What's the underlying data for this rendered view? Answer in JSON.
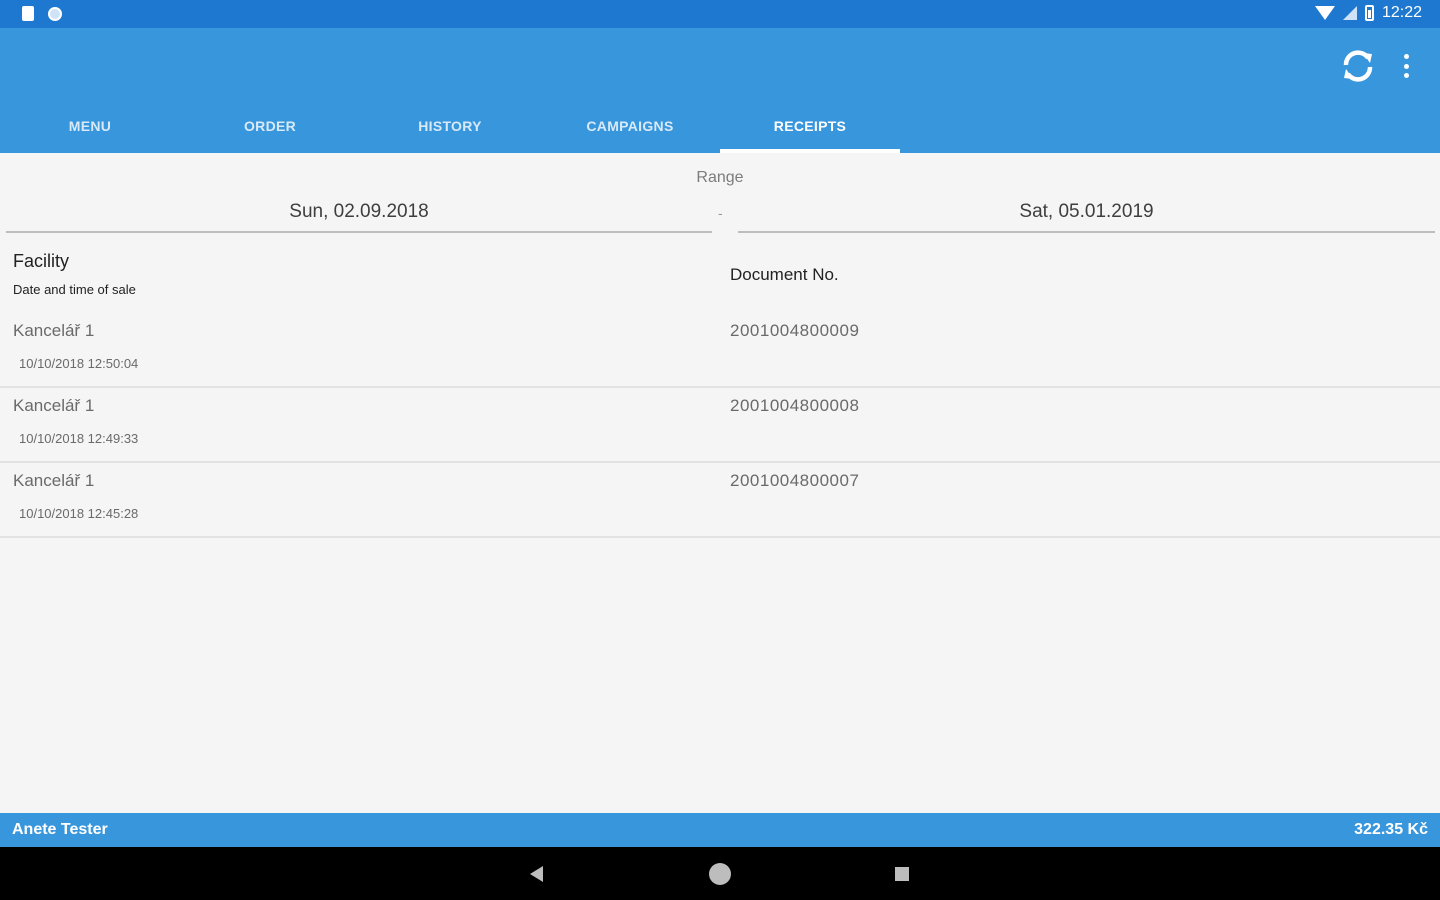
{
  "status_bar": {
    "time": "12:22"
  },
  "tabs": [
    {
      "label": "MENU"
    },
    {
      "label": "ORDER"
    },
    {
      "label": "HISTORY"
    },
    {
      "label": "CAMPAIGNS"
    },
    {
      "label": "RECEIPTS",
      "active": true
    }
  ],
  "range": {
    "label": "Range",
    "from": "Sun, 02.09.2018",
    "separator": "-",
    "to": "Sat, 05.01.2019"
  },
  "headers": {
    "facility": "Facility",
    "datetime": "Date and time of sale",
    "document_no": "Document No."
  },
  "receipts": [
    {
      "facility": "Kancelář 1",
      "datetime": "10/10/2018 12:50:04",
      "document_no": "2001004800009"
    },
    {
      "facility": "Kancelář 1",
      "datetime": "10/10/2018 12:49:33",
      "document_no": "2001004800008"
    },
    {
      "facility": "Kancelář 1",
      "datetime": "10/10/2018 12:45:28",
      "document_no": "2001004800007"
    }
  ],
  "footer": {
    "user": "Anete Tester",
    "total": "322.35 Kč"
  },
  "icons": {
    "refresh": "refresh-icon",
    "overflow": "more-vert-icon",
    "wifi": "wifi-icon",
    "battery": "battery-icon"
  },
  "colors": {
    "primary": "#3796dc",
    "status_bar": "#1e78d0"
  }
}
